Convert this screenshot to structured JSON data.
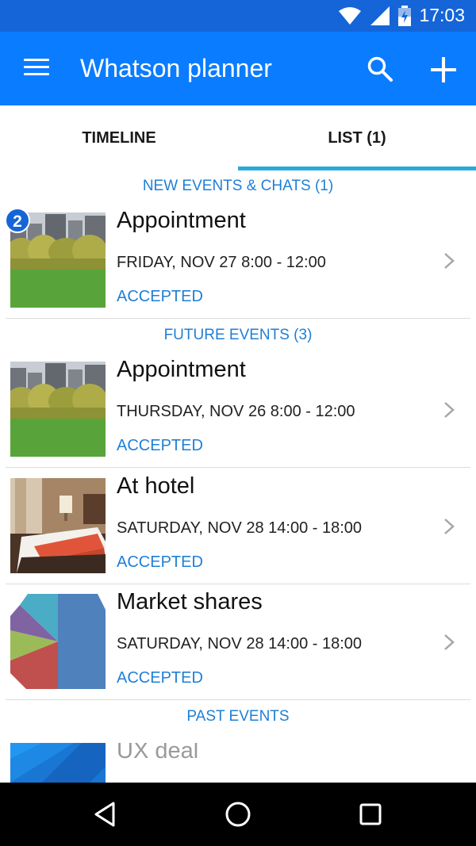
{
  "status_bar": {
    "time": "17:03",
    "icons": [
      "wifi-icon",
      "signal-icon",
      "battery-icon"
    ]
  },
  "app_bar": {
    "title": "Whatson planner",
    "icons": [
      "menu-icon",
      "search-icon",
      "add-icon"
    ]
  },
  "tabs": [
    {
      "label": "TIMELINE",
      "selected": false
    },
    {
      "label": "LIST (1)",
      "selected": true
    }
  ],
  "sections": {
    "new": {
      "label": "NEW EVENTS & CHATS (1)"
    },
    "future": {
      "label": "FUTURE EVENTS (3)"
    },
    "past": {
      "label": "PAST EVENTS"
    }
  },
  "events": [
    {
      "title": "Appointment",
      "date": "FRIDAY, NOV 27  8:00 - 12:00",
      "status": "ACCEPTED",
      "badge": "2",
      "thumbnail": "park"
    },
    {
      "title": "Appointment",
      "date": "THURSDAY, NOV 26  8:00 - 12:00",
      "status": "ACCEPTED",
      "thumbnail": "park"
    },
    {
      "title": "At hotel",
      "date": "SATURDAY, NOV 28  14:00 - 18:00",
      "status": "ACCEPTED",
      "thumbnail": "hotel-room"
    },
    {
      "title": "Market shares",
      "date": "SATURDAY, NOV 28  14:00 - 18:00",
      "status": "ACCEPTED",
      "thumbnail": "pie-chart"
    },
    {
      "title": "UX deal",
      "thumbnail": "blue-abstract"
    }
  ],
  "nav_bar": {
    "icons": [
      "back-icon",
      "home-icon",
      "recents-icon"
    ]
  },
  "colors": {
    "status_bar": "#1565d8",
    "app_bar": "#0a7cff",
    "accent": "#1f7fd6",
    "tab_indicator": "#2aa8dd"
  }
}
